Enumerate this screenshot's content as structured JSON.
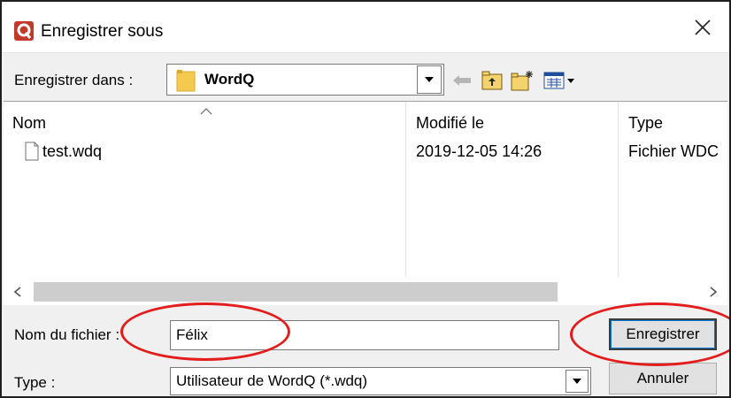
{
  "window": {
    "title": "Enregistrer sous",
    "app_icon": "wordq-app-icon",
    "close_glyph": "✕"
  },
  "toolbar": {
    "lookin_label": "Enregistrer dans :",
    "lookin_value": "WordQ",
    "icons": [
      "back-arrow-icon",
      "up-folder-icon",
      "new-folder-icon",
      "view-menu-icon"
    ]
  },
  "file_list": {
    "columns": [
      "Nom",
      "Modifié le",
      "Type"
    ],
    "rows": [
      {
        "name": "test.wdq",
        "modified": "2019-12-05 14:26",
        "type": "Fichier WDC"
      }
    ]
  },
  "form": {
    "filename_label": "Nom du fichier :",
    "filename_value": "Félix",
    "type_label": "Type :",
    "type_value": "Utilisateur de WordQ (*.wdq)"
  },
  "buttons": {
    "save_label": "Enregistrer",
    "cancel_label": "Annuler"
  },
  "colors": {
    "annotation": "#e31c1c",
    "folder": "#f3c94e",
    "app_icon": "#c0392b"
  }
}
